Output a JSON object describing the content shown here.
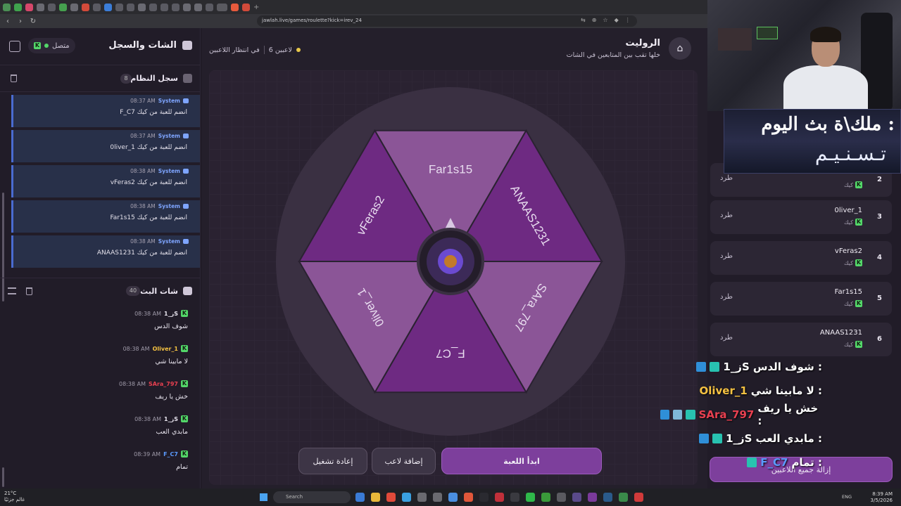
{
  "browser": {
    "url": "jawlah.live/games/roulette?kick=irev_24"
  },
  "left_panel": {
    "title": "الشات والسجل",
    "status": "متصل",
    "system_log": {
      "title": "سجل النظام",
      "count": "8",
      "entries": [
        {
          "who": "System",
          "time": "08:37 AM",
          "text": "F_C7 انضم للعبة من كيك"
        },
        {
          "who": "System",
          "time": "08:37 AM",
          "text": "0liver_1 انضم للعبة من كيك"
        },
        {
          "who": "System",
          "time": "08:38 AM",
          "text": "vFeras2 انضم للعبة من كيك"
        },
        {
          "who": "System",
          "time": "08:38 AM",
          "text": "Far1s15 انضم للعبة من كيك"
        },
        {
          "who": "System",
          "time": "08:38 AM",
          "text": "ANAAS1231 انضم للعبة من كيك"
        }
      ]
    },
    "stream_chat": {
      "title": "شات البث",
      "count": "40",
      "messages": [
        {
          "user": "ز_1S",
          "time": "08:38 AM",
          "text": "شوف الدس",
          "color": "#e8e4ee"
        },
        {
          "user": "Oliver_1",
          "time": "08:38 AM",
          "text": "لا مابينا شي",
          "color": "#f5c242"
        },
        {
          "user": "SAra_797",
          "time": "08:38 AM",
          "text": "خش يا ريف",
          "color": "#e84050"
        },
        {
          "user": "ز_1S",
          "time": "08:38 AM",
          "text": "مابدي العب",
          "color": "#e8e4ee"
        },
        {
          "user": "F_C7",
          "time": "08:39 AM",
          "text": "تمام",
          "color": "#5b9bff"
        }
      ]
    }
  },
  "game": {
    "title": "الروليت",
    "subtitle": "خلها تقب بين المتابعين في الشات",
    "players_count": "6 لاعبين",
    "state": "في انتظار اللاعبين",
    "wheel_segments": [
      "Far1s15",
      "ANAAS1231",
      "SAra_797",
      "F_C7",
      "0liver_1",
      "vFeras2"
    ],
    "segment_colors": [
      "#8b5597",
      "#6e2a82"
    ],
    "buttons": {
      "start": "ابدأ اللعبة",
      "add": "إضافة لاعب",
      "reset": "إعادة تشغيل"
    }
  },
  "players_panel": {
    "players": [
      {
        "num": "2",
        "name": "",
        "platform": "كيك",
        "kick": "طرد"
      },
      {
        "num": "3",
        "name": "0liver_1",
        "platform": "كيك",
        "kick": "طرد"
      },
      {
        "num": "4",
        "name": "vFeras2",
        "platform": "كيك",
        "kick": "طرد"
      },
      {
        "num": "5",
        "name": "Far1s15",
        "platform": "كيك",
        "kick": "طرد"
      },
      {
        "num": "6",
        "name": "ANAAS1231",
        "platform": "كيك",
        "kick": "طرد"
      }
    ],
    "remove_all": "إزالة جميع اللاعبين"
  },
  "banner": {
    "line1": "ملك\\ة بث اليوم :",
    "line2": "تـسـنـيـم"
  },
  "overlay_chat": [
    {
      "text": "شوف الدس :",
      "user": "ز_1S",
      "color": "#ffffff"
    },
    {
      "text": "لا مابينا شي :",
      "user": "Oliver_1",
      "color": "#f5c242"
    },
    {
      "text": "خش يا ريف :",
      "user": "SAra_797",
      "color": "#e84050"
    },
    {
      "text": "مابدي العب :",
      "user": "ز_1S",
      "color": "#ffffff"
    },
    {
      "text": "تمام :",
      "user": "F_C7",
      "color": "#5b9bff"
    }
  ],
  "taskbar": {
    "weather_temp": "21°C",
    "weather_desc": "غالم جزئيًا",
    "search": "Search",
    "lang": "ENG",
    "time": "8:39 AM",
    "date": "3/5/2026"
  }
}
